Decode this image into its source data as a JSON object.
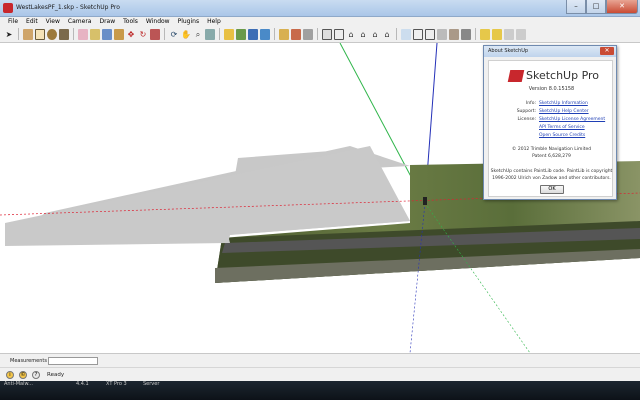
{
  "window": {
    "title": "WestLakesPF_1.skp - SketchUp Pro",
    "minimize": "–",
    "maximize": "□",
    "close": "✕"
  },
  "menu": [
    "File",
    "Edit",
    "View",
    "Camera",
    "Draw",
    "Tools",
    "Window",
    "Plugins",
    "Help"
  ],
  "about": {
    "title": "About SketchUp",
    "close": "✕",
    "product": "SketchUp Pro",
    "version": "Version 8.0.15158",
    "rows": [
      {
        "key": "Info:",
        "link": "SketchUp Information"
      },
      {
        "key": "Support:",
        "link": "SketchUp Help Center"
      },
      {
        "key": "License:",
        "link": "SketchUp License Agreement"
      },
      {
        "key": "",
        "link": "API Terms of Service"
      },
      {
        "key": "",
        "link": "Open Source Credits"
      }
    ],
    "copyright": "© 2012 Trimble Navigation Limited",
    "patent": "Patent 6,628,279",
    "note1": "SketchUp contains PaintLib code.  PaintLib is copyright",
    "note2": "1996-2002 Ulrich von Zadow and other contributors.",
    "ok": "OK"
  },
  "measurements_label": "Measurements",
  "status": {
    "text": "Ready",
    "icon1": "i",
    "icon2": "©",
    "icon3": "?"
  },
  "taskbar": [
    {
      "line1": "Anti-Malw...",
      "line2": ""
    },
    {
      "line1": "",
      "line2": ""
    },
    {
      "line1": "",
      "line2": "4.4.1"
    },
    {
      "line1": "",
      "line2": "XT Pro 3"
    },
    {
      "line1": "",
      "line2": "Server"
    }
  ]
}
